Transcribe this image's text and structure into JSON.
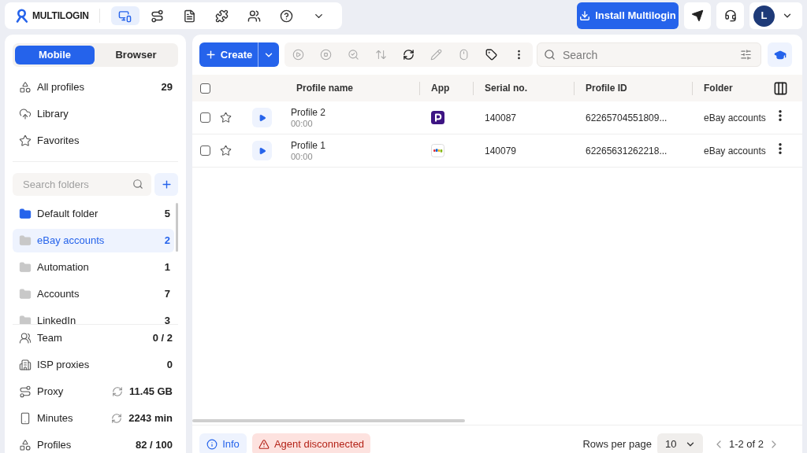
{
  "top_bar": {
    "brand": "MULTILOGIN",
    "nav": [
      {
        "selected": true
      },
      {
        "selected": false
      },
      {
        "selected": false
      },
      {
        "selected": false
      },
      {
        "selected": false
      },
      {
        "selected": false
      }
    ],
    "install_button": "Install Multilogin",
    "avatar": "L"
  },
  "sidebar": {
    "mode_tabs": [
      {
        "label": "Mobile",
        "selected": true
      },
      {
        "label": "Browser",
        "selected": false
      }
    ],
    "nav_items": [
      {
        "label": "All profiles",
        "count": "29"
      },
      {
        "label": "Library"
      },
      {
        "label": "Favorites"
      }
    ],
    "folder_search": {
      "placeholder": "Search folders"
    },
    "folders": [
      {
        "name": "Default folder",
        "count": "5",
        "selected": false,
        "color": "#2563eb"
      },
      {
        "name": "eBay accounts",
        "count": "2",
        "selected": true,
        "color": "#c8c8c8"
      },
      {
        "name": "Automation",
        "count": "1",
        "selected": false,
        "color": "#c8c8c8"
      },
      {
        "name": "Accounts",
        "count": "7",
        "selected": false,
        "color": "#c8c8c8"
      },
      {
        "name": "LinkedIn",
        "count": "3",
        "selected": false,
        "color": "#c8c8c8"
      }
    ],
    "stats": [
      {
        "label": "Team",
        "value": "0 / 2",
        "sync": false
      },
      {
        "label": "ISP proxies",
        "value": "0",
        "sync": false
      },
      {
        "label": "Proxy",
        "value": "11.45 GB",
        "sync": true
      },
      {
        "label": "Minutes",
        "value": "2243 min",
        "sync": true
      },
      {
        "label": "Profiles",
        "value": "82 / 100",
        "sync": false
      }
    ]
  },
  "toolbar": {
    "create_button": "Create",
    "tools": [
      {
        "disabled": true
      },
      {
        "disabled": true
      },
      {
        "disabled": true
      },
      {
        "disabled": true
      },
      {
        "disabled": false
      },
      {
        "disabled": true
      },
      {
        "disabled": true
      },
      {
        "disabled": false
      },
      {
        "disabled": false
      }
    ],
    "search": {
      "placeholder": "Search"
    }
  },
  "table": {
    "select_all_checked": false,
    "columns": [
      "Profile name",
      "App",
      "Serial no.",
      "Profile ID",
      "Folder"
    ],
    "rows": [
      {
        "checked": false,
        "favorite": false,
        "name": "Profile 2",
        "time": "00:00",
        "app": {
          "kind": "badge"
        },
        "serial": "140087",
        "profile_id": "62265704551809...",
        "folder": "eBay accounts"
      },
      {
        "checked": false,
        "favorite": false,
        "name": "Profile 1",
        "time": "00:00",
        "app": {
          "kind": "wordmark"
        },
        "serial": "140079",
        "profile_id": "62265631262218...",
        "folder": "eBay accounts"
      }
    ]
  },
  "footer": {
    "info_button": "Info",
    "alert": "Agent disconnected",
    "rows_per_page_label": "Rows per page",
    "rows_per_page": "10",
    "range": "1-2 of 2"
  }
}
